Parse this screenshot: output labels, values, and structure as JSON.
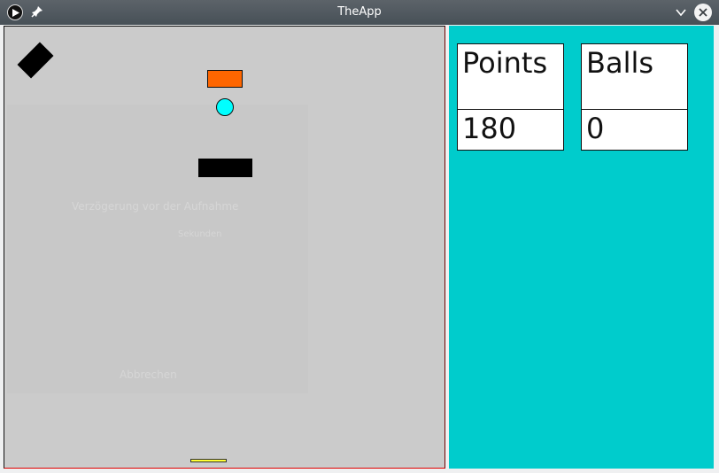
{
  "window": {
    "title": "TheApp",
    "titlebar_color": "#505860",
    "icons": [
      "app-play-icon",
      "pin-icon",
      "minimize-icon",
      "close-icon"
    ]
  },
  "game": {
    "background": "#cbcbcb",
    "objects": [
      {
        "name": "black-diamond",
        "color": "#000000"
      },
      {
        "name": "orange-brick",
        "color": "#fe6600"
      },
      {
        "name": "ball",
        "color": "#00ffff"
      },
      {
        "name": "black-block",
        "color": "#000000"
      },
      {
        "name": "paddle",
        "color": "#ffff33"
      }
    ],
    "ghost_text": {
      "line1": "Verzögerung vor der Aufnahme",
      "line2": "Sekunden",
      "line3": "Abbrechen"
    }
  },
  "scoreboard": {
    "background": "#00cccc",
    "points": {
      "label": "Points",
      "value": "180"
    },
    "balls": {
      "label": "Balls",
      "value": "0"
    }
  }
}
